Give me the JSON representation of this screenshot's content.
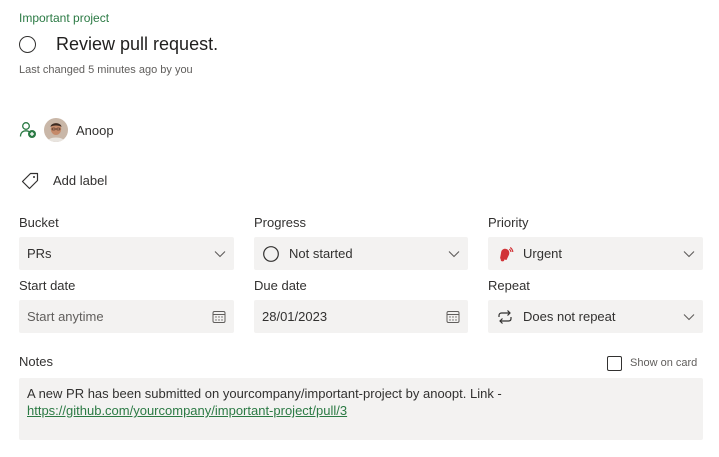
{
  "task": {
    "plan_name": "Important project",
    "title": "Review pull request.",
    "last_changed": "Last changed 5 minutes ago by you"
  },
  "assignment": {
    "assign_icon": "person-add-icon",
    "assignee_name": "Anoop"
  },
  "labels": {
    "add_label_text": "Add label",
    "icon": "tag-icon"
  },
  "fields": {
    "bucket": {
      "label": "Bucket",
      "value": "PRs"
    },
    "progress": {
      "label": "Progress",
      "value": "Not started",
      "icon": "empty-circle-icon"
    },
    "priority": {
      "label": "Priority",
      "value": "Urgent",
      "icon": "bell-urgent-icon",
      "color": "#d13438"
    },
    "start_date": {
      "label": "Start date",
      "placeholder": "Start anytime"
    },
    "due_date": {
      "label": "Due date",
      "value": "28/01/2023"
    },
    "repeat": {
      "label": "Repeat",
      "value": "Does not repeat",
      "icon": "repeat-icon"
    }
  },
  "notes": {
    "label": "Notes",
    "show_on_card_label": "Show on card",
    "show_on_card_checked": false,
    "text": "A new PR has been submitted on yourcompany/important-project by anoopt. Link -",
    "link": "https://github.com/yourcompany/important-project/pull/3"
  },
  "colors": {
    "accent_green": "#2b7a44",
    "field_background": "#f3f2f1",
    "text": "#323130"
  }
}
